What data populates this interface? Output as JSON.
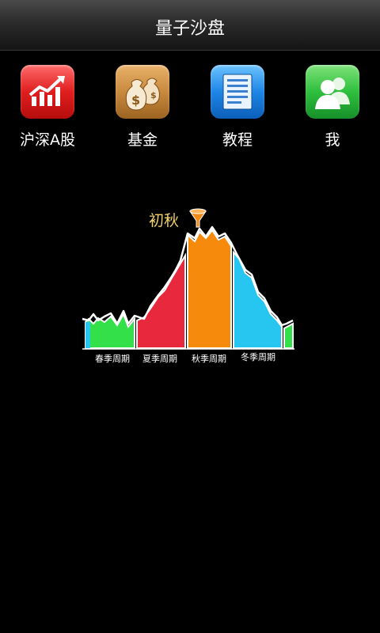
{
  "app": {
    "title": "量子沙盘"
  },
  "nav": {
    "items": [
      {
        "label": "沪深A股",
        "icon": "stock-chart-icon",
        "color": "#e01e1e"
      },
      {
        "label": "基金",
        "icon": "money-bag-icon",
        "color": "#c98a3e"
      },
      {
        "label": "教程",
        "icon": "document-icon",
        "color": "#1e86e6"
      },
      {
        "label": "我",
        "icon": "users-icon",
        "color": "#2fbf3d"
      }
    ]
  },
  "cycle": {
    "current_label": "初秋",
    "marker_icon": "funnel-marker-icon",
    "seasons": [
      {
        "label": "春季周期",
        "color": "#33e04a"
      },
      {
        "label": "夏季周期",
        "color": "#e8283c"
      },
      {
        "label": "秋季周期",
        "color": "#f58a0c"
      },
      {
        "label": "冬季周期",
        "color": "#26c6f0"
      }
    ]
  }
}
